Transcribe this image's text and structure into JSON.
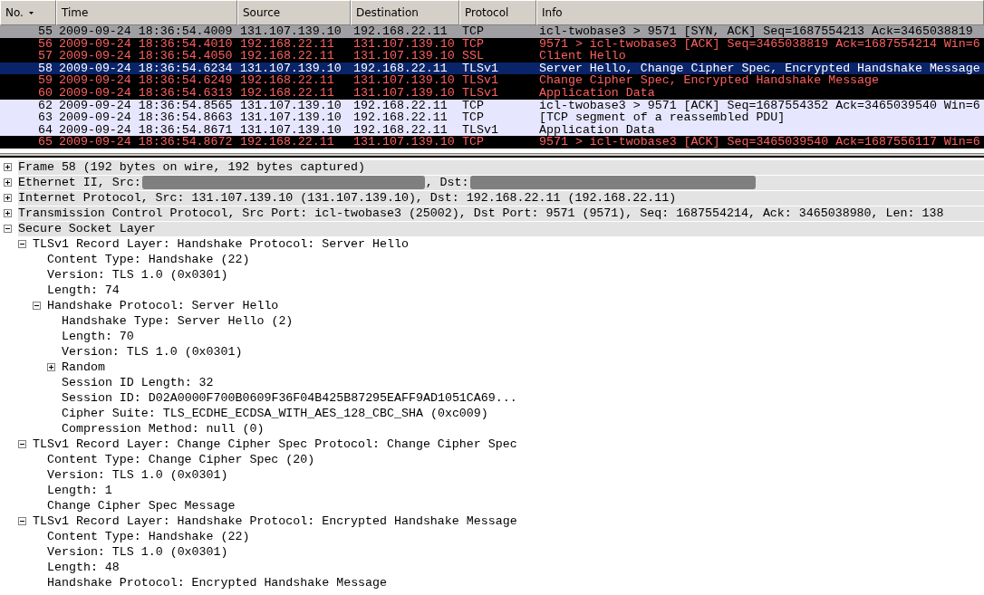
{
  "packet_list": {
    "columns": [
      {
        "label": "No.",
        "sorted": true
      },
      {
        "label": "Time",
        "sorted": false
      },
      {
        "label": "Source",
        "sorted": false
      },
      {
        "label": "Destination",
        "sorted": false
      },
      {
        "label": "Protocol",
        "sorted": false
      },
      {
        "label": "Info",
        "sorted": false
      }
    ],
    "rows": [
      {
        "kind": "syn",
        "selected": false,
        "cells": [
          "55",
          "2009-09-24 18:36:54.4009",
          "131.107.139.10",
          "192.168.22.11",
          "TCP",
          "icl-twobase3 > 9571 [SYN, ACK] Seq=1687554213 Ack=3465038819"
        ]
      },
      {
        "kind": "alert",
        "selected": false,
        "cells": [
          "56",
          "2009-09-24 18:36:54.4010",
          "192.168.22.11",
          "131.107.139.10",
          "TCP",
          "9571 > icl-twobase3 [ACK] Seq=3465038819 Ack=1687554214 Win=6"
        ]
      },
      {
        "kind": "alert",
        "selected": false,
        "cells": [
          "57",
          "2009-09-24 18:36:54.4050",
          "192.168.22.11",
          "131.107.139.10",
          "SSL",
          "Client Hello"
        ]
      },
      {
        "selected": true,
        "cells": [
          "58",
          "2009-09-24 18:36:54.6234",
          "131.107.139.10",
          "192.168.22.11",
          "TLSv1",
          "Server Hello, Change Cipher Spec, Encrypted Handshake Message"
        ]
      },
      {
        "kind": "alert",
        "selected": false,
        "cells": [
          "59",
          "2009-09-24 18:36:54.6249",
          "192.168.22.11",
          "131.107.139.10",
          "TLSv1",
          "Change Cipher Spec, Encrypted Handshake Message"
        ]
      },
      {
        "kind": "alert",
        "selected": false,
        "cells": [
          "60",
          "2009-09-24 18:36:54.6313",
          "192.168.22.11",
          "131.107.139.10",
          "TLSv1",
          "Application Data"
        ]
      },
      {
        "kind": "normal",
        "selected": false,
        "cells": [
          "62",
          "2009-09-24 18:36:54.8565",
          "131.107.139.10",
          "192.168.22.11",
          "TCP",
          "icl-twobase3 > 9571 [ACK] Seq=1687554352 Ack=3465039540 Win=6"
        ]
      },
      {
        "kind": "normal",
        "selected": false,
        "cells": [
          "63",
          "2009-09-24 18:36:54.8663",
          "131.107.139.10",
          "192.168.22.11",
          "TCP",
          "[TCP segment of a reassembled PDU]"
        ]
      },
      {
        "kind": "normal",
        "selected": false,
        "cells": [
          "64",
          "2009-09-24 18:36:54.8671",
          "131.107.139.10",
          "192.168.22.11",
          "TLSv1",
          "Application Data"
        ]
      },
      {
        "kind": "alert",
        "selected": false,
        "cells": [
          "65",
          "2009-09-24 18:36:54.8672",
          "192.168.22.11",
          "131.107.139.10",
          "TCP",
          "9571 > icl-twobase3 [ACK] Seq=3465039540 Ack=1687556117 Win=6"
        ]
      }
    ]
  },
  "packet_details": [
    {
      "text": "Frame 58 (192 bytes on wire, 192 bytes captured)",
      "expanded": false
    },
    {
      "parts": [
        {
          "kind": "text",
          "text": "Ethernet II, Src:"
        },
        {
          "kind": "redacted"
        },
        {
          "kind": "text",
          "text": ", Dst:"
        },
        {
          "kind": "redacted"
        }
      ],
      "expanded": false
    },
    {
      "text": "Internet Protocol, Src: 131.107.139.10 (131.107.139.10), Dst: 192.168.22.11 (192.168.22.11)",
      "expanded": false
    },
    {
      "text": "Transmission Control Protocol, Src Port: icl-twobase3 (25002), Dst Port: 9571 (9571), Seq: 1687554214, Ack: 3465038980, Len: 138",
      "expanded": false
    },
    {
      "text": "Secure Socket Layer",
      "expanded": true,
      "children": [
        {
          "text": "TLSv1 Record Layer: Handshake Protocol: Server Hello",
          "expanded": true,
          "children": [
            {
              "text": "Content Type: Handshake (22)"
            },
            {
              "text": "Version: TLS 1.0 (0x0301)"
            },
            {
              "text": "Length: 74"
            },
            {
              "text": "Handshake Protocol: Server Hello",
              "expanded": true,
              "children": [
                {
                  "text": "Handshake Type: Server Hello (2)"
                },
                {
                  "text": "Length: 70"
                },
                {
                  "text": "Version: TLS 1.0 (0x0301)"
                },
                {
                  "text": "Random",
                  "expanded": false
                },
                {
                  "text": "Session ID Length: 32"
                },
                {
                  "text": "Session ID: D02A0000F700B0609F36F04B425B87295EAFF9AD1051CA69..."
                },
                {
                  "text": "Cipher Suite: TLS_ECDHE_ECDSA_WITH_AES_128_CBC_SHA (0xc009)"
                },
                {
                  "text": "Compression Method: null (0)"
                }
              ]
            }
          ]
        },
        {
          "text": "TLSv1 Record Layer: Change Cipher Spec Protocol: Change Cipher Spec",
          "expanded": true,
          "children": [
            {
              "text": "Content Type: Change Cipher Spec (20)"
            },
            {
              "text": "Version: TLS 1.0 (0x0301)"
            },
            {
              "text": "Length: 1"
            },
            {
              "text": "Change Cipher Spec Message"
            }
          ]
        },
        {
          "text": "TLSv1 Record Layer: Handshake Protocol: Encrypted Handshake Message",
          "expanded": true,
          "children": [
            {
              "text": "Content Type: Handshake (22)"
            },
            {
              "text": "Version: TLS 1.0 (0x0301)"
            },
            {
              "text": "Length: 48"
            },
            {
              "text": "Handshake Protocol: Encrypted Handshake Message"
            }
          ]
        }
      ]
    }
  ]
}
